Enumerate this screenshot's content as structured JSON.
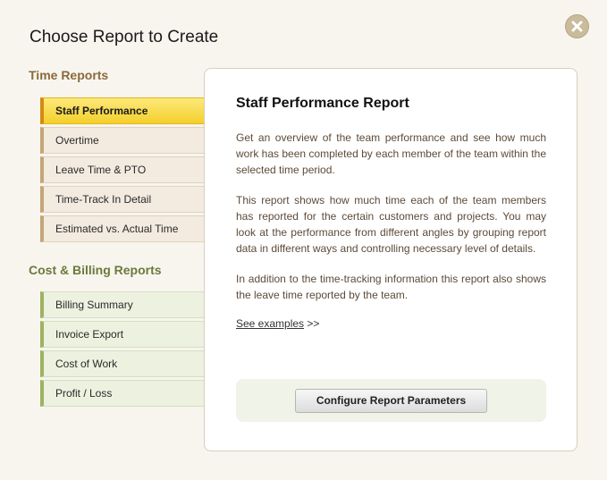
{
  "dialog": {
    "title": "Choose Report to Create",
    "close_icon": "close-icon"
  },
  "sidebar": {
    "time_heading": "Time Reports",
    "time_items": [
      {
        "label": "Staff Performance",
        "active": true
      },
      {
        "label": "Overtime"
      },
      {
        "label": "Leave Time & PTO"
      },
      {
        "label": "Time-Track In Detail"
      },
      {
        "label": "Estimated vs. Actual Time"
      }
    ],
    "billing_heading": "Cost & Billing Reports",
    "billing_items": [
      {
        "label": "Billing Summary"
      },
      {
        "label": "Invoice Export"
      },
      {
        "label": "Cost of Work"
      },
      {
        "label": "Profit / Loss"
      }
    ]
  },
  "panel": {
    "title": "Staff Performance Report",
    "paragraphs": [
      "Get an overview of the team performance and see how much work has been completed by each member of the team within the selected time period.",
      "This report shows how much time each of the team members has reported for the certain customers and projects. You may look at the performance from different angles by grouping report data in different ways and controlling necessary level of details.",
      "In addition to the time-tracking information this report also shows the leave time reported by the team."
    ],
    "examples_link": "See examples",
    "examples_suffix": " >>",
    "configure_button": "Configure Report Parameters"
  },
  "colors": {
    "active_tab": "#f4cf2c",
    "time_accent": "#c3a577",
    "billing_accent": "#9db363",
    "close_button": "#c9bb9b"
  }
}
